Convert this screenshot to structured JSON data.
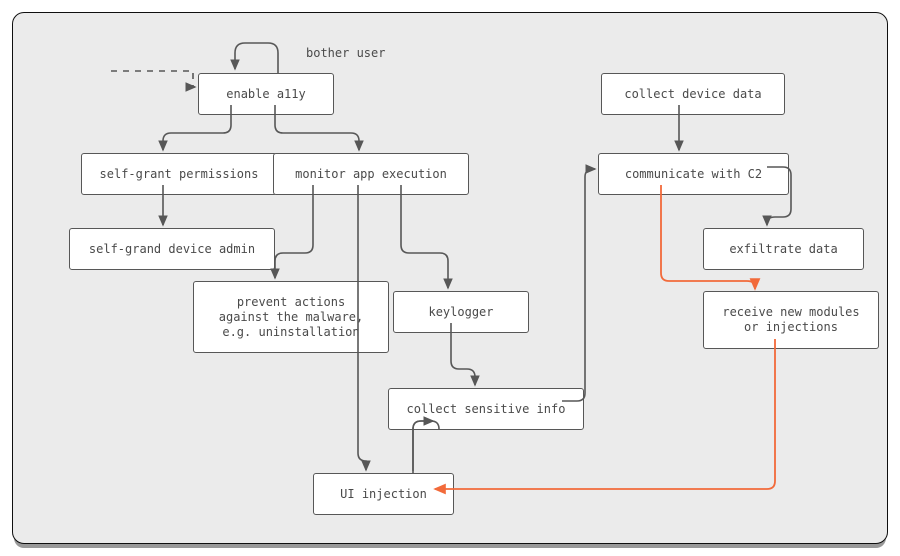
{
  "labels": {
    "bother_user": "bother user",
    "enable_a11y": "enable a11y",
    "self_grant_permissions": "self-grant permissions",
    "monitor_app_execution": "monitor app execution",
    "self_grand_device_admin": "self-grand device admin",
    "prevent_actions": "prevent actions\nagainst the malware,\ne.g. uninstallation",
    "keylogger": "keylogger",
    "collect_sensitive_info": "collect sensitive info",
    "ui_injection": "UI injection",
    "collect_device_data": "collect device data",
    "communicate_c2": "communicate with C2",
    "exfiltrate_data": "exfiltrate data",
    "receive_modules": "receive new modules\nor injections"
  },
  "colors": {
    "edge": "#575757",
    "accent": "#f26a3a"
  }
}
